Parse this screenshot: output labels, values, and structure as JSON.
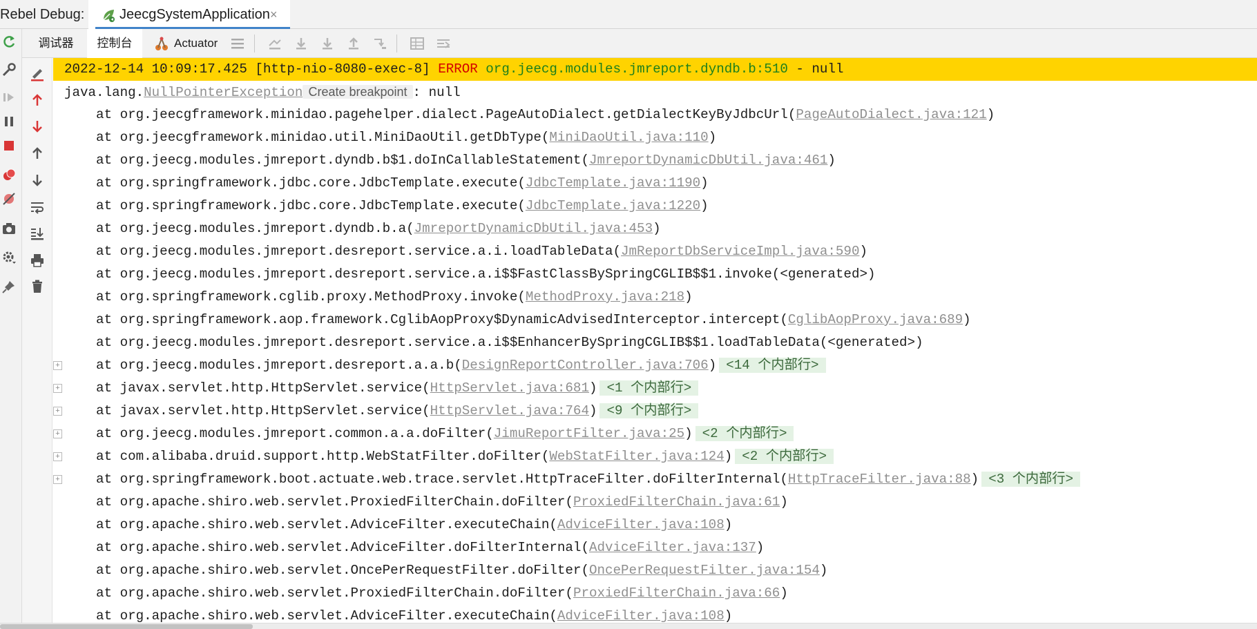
{
  "header": {
    "title": "Rebel Debug:",
    "run_tab_label": "JeecgSystemApplication",
    "run_tab_close": "×"
  },
  "toolbar": {
    "tabs": [
      "调试器",
      "控制台",
      "Actuator"
    ],
    "active_tab_index": 1
  },
  "colors": {
    "error_line_bg": "#ffd300",
    "error_text": "#d30000",
    "logger_text": "#1c7f1c",
    "link_text": "#8f8f8f",
    "accent": "#4083c9"
  },
  "icons": {
    "run_tab": "spring-leaf-icon",
    "left_toolbar": [
      "rerun-icon",
      "wrench-icon",
      "resume-icon",
      "pause-icon",
      "stop-icon",
      "view-breakpoints-icon",
      "mute-breakpoints-icon",
      "camera-icon",
      "settings-icon",
      "pin-icon"
    ],
    "sub_toolbar": [
      "menu-icon",
      "show-execution-point-icon",
      "step-over-icon",
      "step-into-icon",
      "step-out-icon",
      "run-to-cursor-icon",
      "evaluate-table-icon",
      "trace-icon"
    ],
    "console_actions": [
      "clear-highlight-icon",
      "up-red-arrow-icon",
      "down-red-arrow-icon",
      "up-arrow-icon",
      "down-arrow-icon",
      "soft-wrap-icon",
      "scroll-to-end-icon",
      "print-icon",
      "trash-icon"
    ]
  },
  "console": {
    "error_line": {
      "timestamp": "2022-12-14 10:09:17.425",
      "thread": "[http-nio-8080-exec-8]",
      "level": "ERROR",
      "logger": "org.jeecg.modules.jmreport.dyndb.b:510",
      "message": "- null"
    },
    "exception": {
      "prefix": "java.lang.",
      "class": "NullPointerException",
      "hint": "Create breakpoint",
      "suffix": ": null"
    },
    "frames": [
      {
        "method": "org.jeecgframework.minidao.pagehelper.dialect.PageAutoDialect.getDialectKeyByJdbcUrl",
        "link": "PageAutoDialect.java:121",
        "folded": false,
        "inner": ""
      },
      {
        "method": "org.jeecgframework.minidao.util.MiniDaoUtil.getDbType",
        "link": "MiniDaoUtil.java:110",
        "folded": false,
        "inner": ""
      },
      {
        "method": "org.jeecg.modules.jmreport.dyndb.b$1.doInCallableStatement",
        "link": "JmreportDynamicDbUtil.java:461",
        "folded": false,
        "inner": ""
      },
      {
        "method": "org.springframework.jdbc.core.JdbcTemplate.execute",
        "link": "JdbcTemplate.java:1190",
        "folded": false,
        "inner": ""
      },
      {
        "method": "org.springframework.jdbc.core.JdbcTemplate.execute",
        "link": "JdbcTemplate.java:1220",
        "folded": false,
        "inner": ""
      },
      {
        "method": "org.jeecg.modules.jmreport.dyndb.b.a",
        "link": "JmreportDynamicDbUtil.java:453",
        "folded": false,
        "inner": ""
      },
      {
        "method": "org.jeecg.modules.jmreport.desreport.service.a.i.loadTableData",
        "link": "JmReportDbServiceImpl.java:590",
        "folded": false,
        "inner": ""
      },
      {
        "method": "org.jeecg.modules.jmreport.desreport.service.a.i$$FastClassBySpringCGLIB$$1.invoke",
        "link": "",
        "plain": "<generated>",
        "folded": false,
        "inner": ""
      },
      {
        "method": "org.springframework.cglib.proxy.MethodProxy.invoke",
        "link": "MethodProxy.java:218",
        "folded": false,
        "inner": ""
      },
      {
        "method": "org.springframework.aop.framework.CglibAopProxy$DynamicAdvisedInterceptor.intercept",
        "link": "CglibAopProxy.java:689",
        "folded": false,
        "inner": ""
      },
      {
        "method": "org.jeecg.modules.jmreport.desreport.service.a.i$$EnhancerBySpringCGLIB$$1.loadTableData",
        "link": "",
        "plain": "<generated>",
        "folded": false,
        "inner": ""
      },
      {
        "method": "org.jeecg.modules.jmreport.desreport.a.a.b",
        "link": "DesignReportController.java:706",
        "folded": true,
        "inner": "<14 个内部行>"
      },
      {
        "method": "javax.servlet.http.HttpServlet.service",
        "link": "HttpServlet.java:681",
        "folded": true,
        "inner": "<1 个内部行>"
      },
      {
        "method": "javax.servlet.http.HttpServlet.service",
        "link": "HttpServlet.java:764",
        "folded": true,
        "inner": "<9 个内部行>"
      },
      {
        "method": "org.jeecg.modules.jmreport.common.a.a.doFilter",
        "link": "JimuReportFilter.java:25",
        "folded": true,
        "inner": "<2 个内部行>"
      },
      {
        "method": "com.alibaba.druid.support.http.WebStatFilter.doFilter",
        "link": "WebStatFilter.java:124",
        "folded": true,
        "inner": "<2 个内部行>"
      },
      {
        "method": "org.springframework.boot.actuate.web.trace.servlet.HttpTraceFilter.doFilterInternal",
        "link": "HttpTraceFilter.java:88",
        "folded": true,
        "inner": "<3 个内部行>"
      },
      {
        "method": "org.apache.shiro.web.servlet.ProxiedFilterChain.doFilter",
        "link": "ProxiedFilterChain.java:61",
        "folded": false,
        "inner": ""
      },
      {
        "method": "org.apache.shiro.web.servlet.AdviceFilter.executeChain",
        "link": "AdviceFilter.java:108",
        "folded": false,
        "inner": ""
      },
      {
        "method": "org.apache.shiro.web.servlet.AdviceFilter.doFilterInternal",
        "link": "AdviceFilter.java:137",
        "folded": false,
        "inner": ""
      },
      {
        "method": "org.apache.shiro.web.servlet.OncePerRequestFilter.doFilter",
        "link": "OncePerRequestFilter.java:154",
        "folded": false,
        "inner": ""
      },
      {
        "method": "org.apache.shiro.web.servlet.ProxiedFilterChain.doFilter",
        "link": "ProxiedFilterChain.java:66",
        "folded": false,
        "inner": ""
      },
      {
        "method": "org.apache.shiro.web.servlet.AdviceFilter.executeChain",
        "link": "AdviceFilter.java:108",
        "folded": false,
        "inner": ""
      }
    ]
  }
}
